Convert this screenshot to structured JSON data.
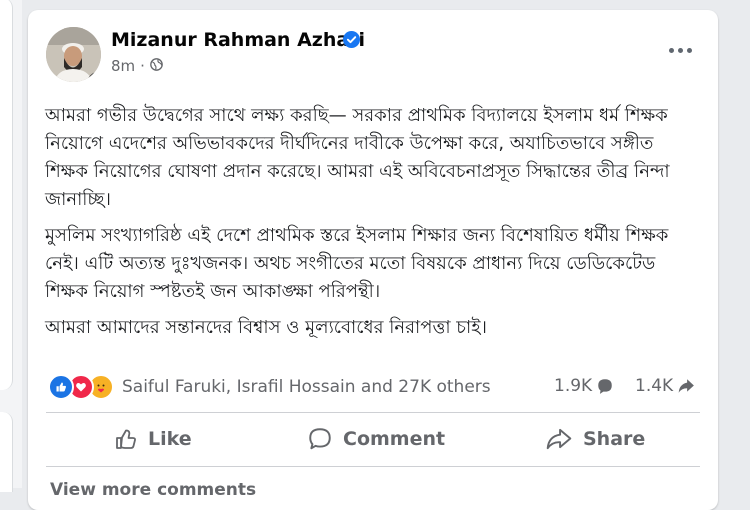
{
  "post": {
    "author": "Mizanur Rahman Azhari",
    "time": "8m",
    "separator": "·",
    "paragraphs": [
      "আমরা গভীর উদ্বেগের সাথে লক্ষ্য করছি— সরকার প্রাথমিক বিদ্যালয়ে ইসলাম ধর্ম শিক্ষক নিয়োগে এদেশের অভিভাবকদের দীর্ঘদিনের দাবীকে উপেক্ষা করে, অযাচিতভাবে সঙ্গীত শিক্ষক নিয়োগের ঘোষণা প্রদান করেছে। আমরা এই অবিবেচনাপ্রসূত সিদ্ধান্তের তীব্র নিন্দা জানাচ্ছি।",
      "মুসলিম সংখ্যাগরিষ্ঠ এই দেশে প্রাথমিক স্তরে ইসলাম শিক্ষার জন্য বিশেষায়িত ধর্মীয় শিক্ষক নেই। এটি অত্যন্ত দুঃখজনক। অথচ সংগীতের মতো বিষয়কে প্রাধান্য দিয়ে ডেডিকেটেড শিক্ষক নিয়োগ স্পষ্টতই জন আকাঙ্ক্ষা পরিপন্থী।",
      "আমরা আমাদের সন্তানদের বিশ্বাস ও মূল্যবোধের নিরাপত্তা চাই।"
    ]
  },
  "stats": {
    "reactions_text": "Saiful Faruki, Israfil Hossain and 27K others",
    "comments": "1.9K",
    "shares": "1.4K"
  },
  "actions": {
    "like": "Like",
    "comment": "Comment",
    "share": "Share"
  },
  "footer": {
    "view_more": "View more comments"
  },
  "colors": {
    "like_blue": "#1b74e4",
    "love_red": "#f0284a",
    "care_yellow": "#f7b125",
    "verified_blue": "#1877f2",
    "secondary_text": "#65676b"
  },
  "icons": [
    "verified-badge-icon",
    "globe-icon",
    "more-options-icon",
    "like-reaction-icon",
    "love-reaction-icon",
    "care-reaction-icon",
    "comment-bubble-icon",
    "share-arrow-icon",
    "thumbs-up-icon"
  ]
}
